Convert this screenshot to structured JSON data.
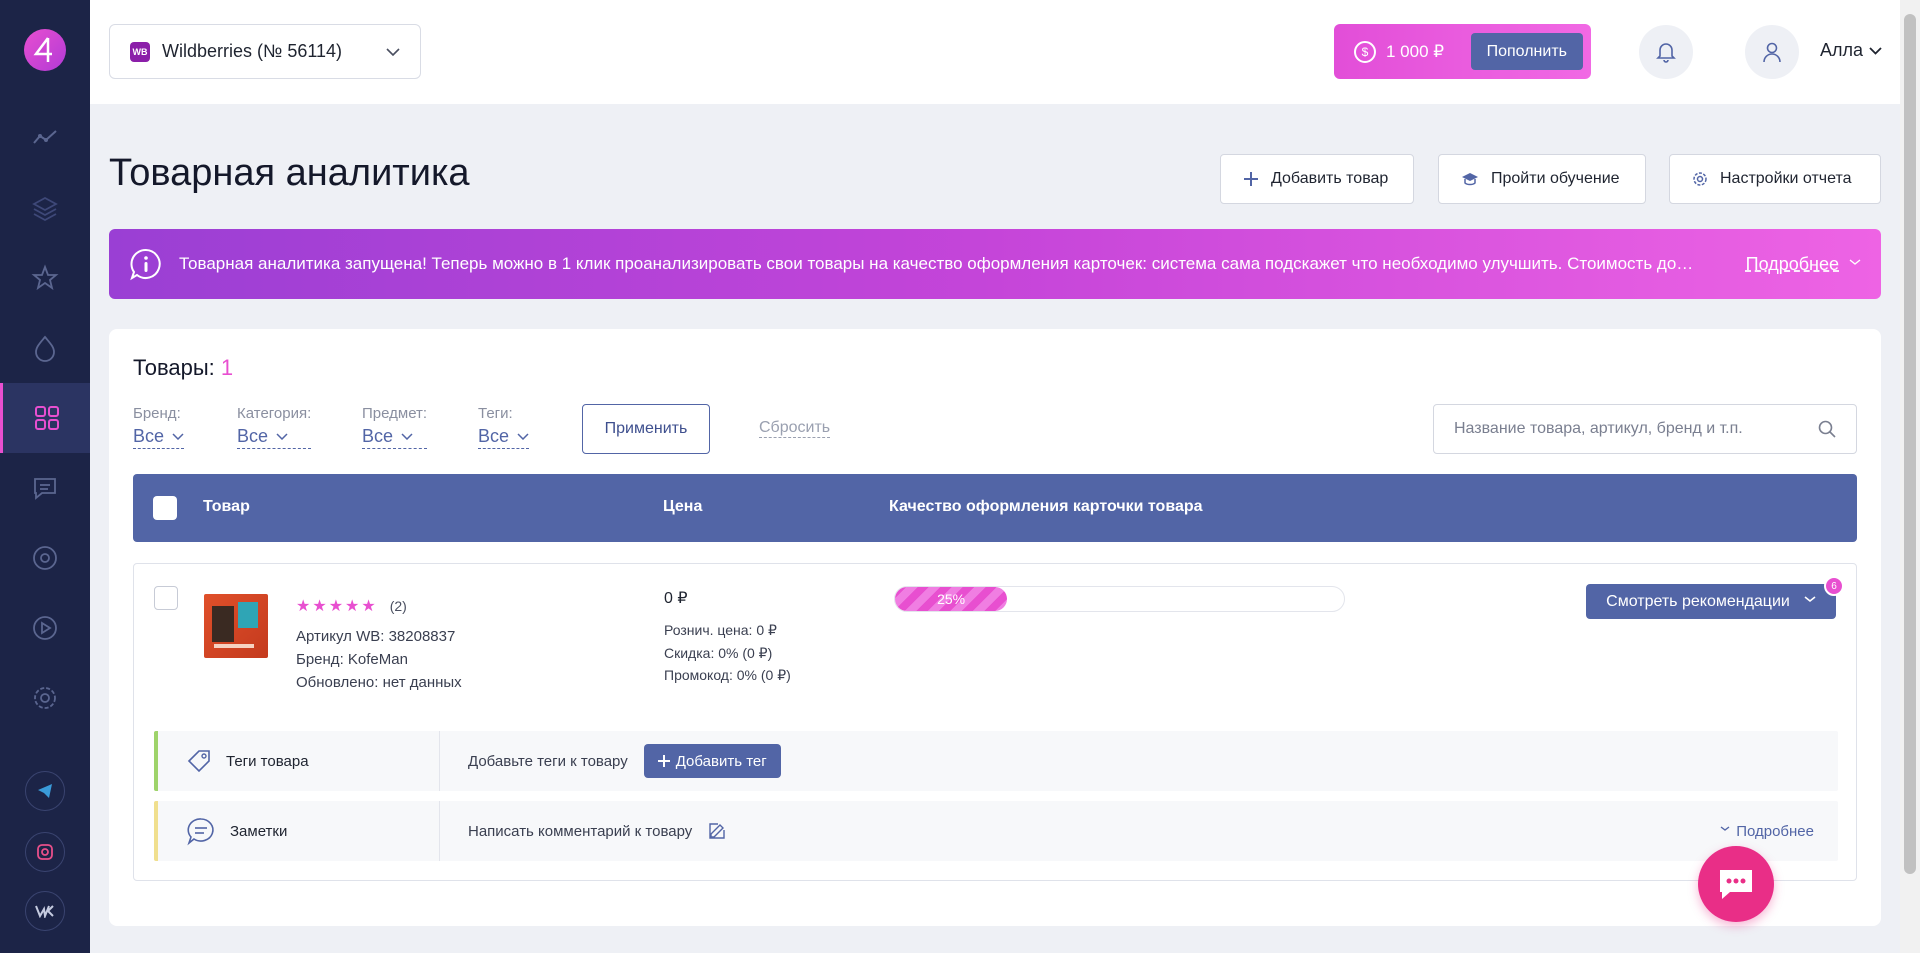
{
  "header": {
    "store_badge": "WB",
    "store_name": "Wildberries (№ 56114)",
    "balance_currency_symbol": "$",
    "balance": "1 000 ₽",
    "topup_label": "Пополнить",
    "user_name": "Алла"
  },
  "page": {
    "title": "Товарная аналитика",
    "actions": {
      "add_product": "Добавить товар",
      "training": "Пройти обучение",
      "report_settings": "Настройки отчета"
    }
  },
  "banner": {
    "text": "Товарная аналитика запущена! Теперь можно в 1 клик проанализировать свои товары на качество оформления карточек: система сама подскажет что необходимо улучшить. Стоимость до…",
    "more_label": "Подробнее"
  },
  "products": {
    "title_prefix": "Товары:",
    "count": "1"
  },
  "filters": {
    "brand": {
      "label": "Бренд:",
      "value": "Все"
    },
    "category": {
      "label": "Категория:",
      "value": "Все"
    },
    "subject": {
      "label": "Предмет:",
      "value": "Все"
    },
    "tags": {
      "label": "Теги:",
      "value": "Все"
    },
    "apply_label": "Применить",
    "reset_label": "Сбросить",
    "search_placeholder": "Название товара, артикул, бренд и т.п."
  },
  "table": {
    "columns": {
      "product": "Товар",
      "price": "Цена",
      "quality": "Качество оформления карточки товара"
    }
  },
  "row": {
    "stars": "★★★★★",
    "rating_count": "(2)",
    "article": "Артикул WB: 38208837",
    "brand": "Бренд: KofeMan",
    "updated": "Обновлено: нет данных",
    "price": "0 ₽",
    "retail_price": "Рознич. цена: 0 ₽",
    "discount": "Скидка: 0% (0 ₽)",
    "promo": "Промокод: 0% (0 ₽)",
    "quality_percent": 25,
    "quality_label": "25%",
    "recommendations_label": "Смотреть рекомендации",
    "recommendations_count": "6",
    "tags_label": "Теги товара",
    "tags_hint": "Добавьте теги к товару",
    "add_tag_label": "Добавить тег",
    "notes_label": "Заметки",
    "notes_hint": "Написать комментарий к товару",
    "details_label": "Подробнее"
  },
  "colors": {
    "sidebar": "#1c2447",
    "accent": "#e84fd0",
    "primary": "#5265a6",
    "chat": "#e92e87"
  }
}
